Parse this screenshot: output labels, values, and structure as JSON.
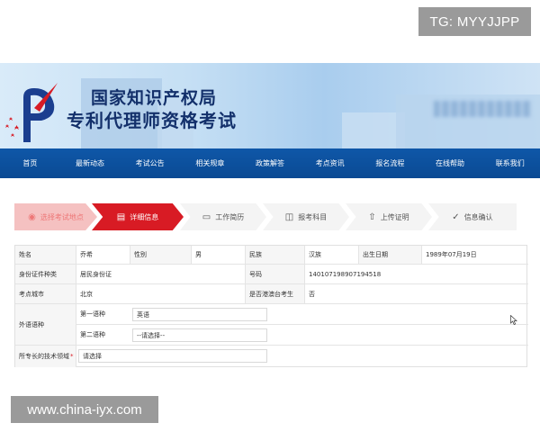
{
  "watermarks": {
    "top": "TG: MYYJJPP",
    "bottom": "www.china-iyx.com"
  },
  "header": {
    "title_line1": "国家知识产权局",
    "title_line2": "专利代理师资格考试"
  },
  "nav": {
    "items": [
      "首页",
      "最新动态",
      "考试公告",
      "相关规章",
      "政策解答",
      "考点资讯",
      "报名流程",
      "在线帮助",
      "联系我们"
    ]
  },
  "steps": [
    {
      "label": "选择考试地点",
      "icon": "location-icon",
      "state": "done"
    },
    {
      "label": "详细信息",
      "icon": "document-icon",
      "state": "active"
    },
    {
      "label": "工作简历",
      "icon": "folder-icon",
      "state": "pending"
    },
    {
      "label": "报考科目",
      "icon": "book-icon",
      "state": "pending"
    },
    {
      "label": "上传证明",
      "icon": "upload-icon",
      "state": "pending"
    },
    {
      "label": "信息确认",
      "icon": "check-circle-icon",
      "state": "pending"
    }
  ],
  "form": {
    "name_label": "姓名",
    "name_value": "乔希",
    "gender_label": "性别",
    "gender_value": "男",
    "ethnicity_label": "民族",
    "ethnicity_value": "汉族",
    "birth_label": "出生日期",
    "birth_value": "1989年07月19日",
    "id_type_label": "身份证件种类",
    "id_type_value": "居民身份证",
    "id_number_label": "号码",
    "id_number_value": "140107198907194518",
    "city_label": "考点城市",
    "city_value": "北京",
    "hk_label": "是否港澳台考生",
    "hk_value": "否",
    "foreign_label": "外语语种",
    "lang1_label": "第一语种",
    "lang1_value": "英语",
    "lang2_label": "第二语种",
    "lang2_value": "--请选择--",
    "tech_label": "所专长的技术领域",
    "tech_required": "*",
    "tech_value": "请选择"
  },
  "colors": {
    "nav_bg": "#0b4f9c",
    "active_step": "#d81b24",
    "done_step": "#f5c1c1"
  }
}
